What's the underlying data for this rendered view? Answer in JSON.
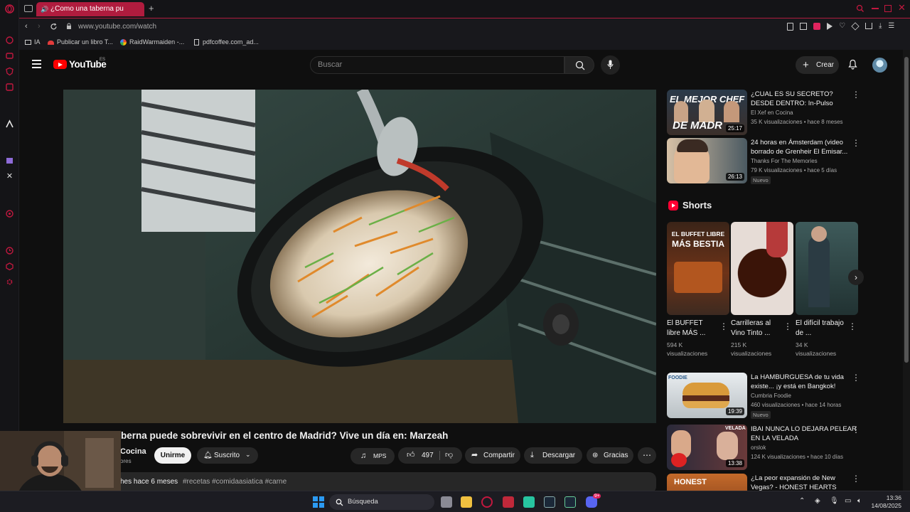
{
  "browser": {
    "tab_title": "¿Como una taberna pu",
    "url": "www.youtube.com/watch",
    "bookmarks": [
      "IA",
      "Publicar un libro T...",
      "RaidWarmaiden -...",
      "pdfcoffee.com_ad..."
    ]
  },
  "youtube": {
    "logo_text": "YouTube",
    "country_code": "ES",
    "search_placeholder": "Buscar",
    "create_label": "Crear"
  },
  "video": {
    "title": "berna puede sobrevivir en el centro de Madrid? Vive un día en: Marzeah",
    "channel_name": "Cocina",
    "channel_sub": "ores",
    "join_label": "Unirme",
    "subscribed_label": "Suscrito",
    "mps_label": "MPS",
    "likes": "497",
    "share_label": "Compartir",
    "download_label": "Descargar",
    "thanks_label": "Gracias",
    "desc_meta": "hes  hace 6 meses",
    "desc_tags": "#recetas #comidaasiatica #carne"
  },
  "recommendations_top": [
    {
      "title": "¿CUAL ES SU SECRETO?  DESDE DENTRO: In-Pulso",
      "channel": "El Xef en Cocina",
      "meta": "35 K visualizaciones • hace 8 meses",
      "duration": "25:17",
      "thumb_text_1": "EL MEJOR CHEF",
      "thumb_text_2": "DE MADR"
    },
    {
      "title": "24 horas en Ámsterdam (video borrado de Grenheir El Emisar...",
      "channel": "Thanks For The Memories",
      "meta": "79 K visualizaciones • hace 5 días",
      "duration": "26:13",
      "badge": "Nuevo"
    }
  ],
  "shorts": {
    "heading": "Shorts",
    "items": [
      {
        "title": "El BUFFET libre MÁS ...",
        "views": "594 K visualizaciones",
        "thumb_text_1": "EL BUFFET LIBRE",
        "thumb_text_2": "MÁS BESTIA"
      },
      {
        "title": "Carrilleras al Vino Tinto ...",
        "views": "215 K visualizaciones"
      },
      {
        "title": "El difícil trabajo de ...",
        "views": "34 K visualizaciones"
      }
    ]
  },
  "recommendations_bottom": [
    {
      "title": "La HAMBURGUESA de tu vida existe... ¡y está en Bangkok!",
      "channel": "Cumbria Foodie",
      "meta": "460 visualizaciones • hace 14 horas",
      "duration": "19:39",
      "badge": "Nuevo",
      "thumb_text_1": "FOODIE"
    },
    {
      "title": "IBAI NUNCA LO DEJARA PELEAR EN LA VELADA",
      "channel": "orslok",
      "meta": "124 K visualizaciones • hace 10 días",
      "duration": "13:38",
      "thumb_text_1": "VELADA"
    },
    {
      "title": "¿La peor expansión de New Vegas? - HONEST HEARTS",
      "channel": "",
      "meta": "",
      "duration": "",
      "thumb_text_1": "HONEST"
    }
  ],
  "taskbar": {
    "search_label": "Búsqueda",
    "time": "13:36",
    "date": "14/08/2025",
    "notification_count": "9+"
  },
  "colors": {
    "opera_red": "#b01c3e",
    "yt_red": "#ff0000",
    "bg": "#0f0f0f",
    "pill": "#272727"
  }
}
